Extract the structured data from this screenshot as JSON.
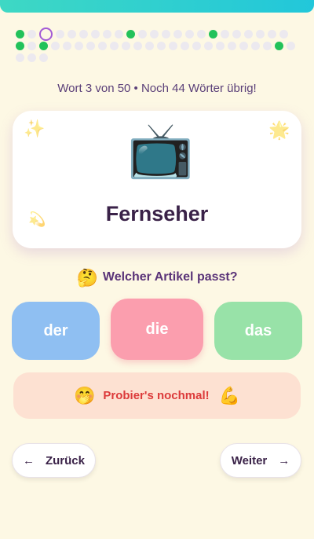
{
  "progress": {
    "total": 50,
    "current_index": 2,
    "done_indices": [
      0,
      9,
      16,
      23,
      25,
      45
    ],
    "text": "Wort 3 von 50  • Noch 44 Wörter übrig!"
  },
  "card": {
    "icon": "📺",
    "icon_name": "television-icon",
    "word": "Fernseher"
  },
  "question": {
    "emoji": "🤔",
    "text": "Welcher Artikel passt?"
  },
  "articles": [
    {
      "label": "der",
      "color": "#8fbff2"
    },
    {
      "label": "die",
      "color": "#fb9eae"
    },
    {
      "label": "das",
      "color": "#98e2a8"
    }
  ],
  "feedback": {
    "emoji_left": "🤭",
    "text": "Probier's nochmal!",
    "emoji_right": "💪",
    "color": "#dc3a3a"
  },
  "nav": {
    "back_label": "Zurück",
    "back_arrow": "←",
    "next_label": "Weiter",
    "next_arrow": "→"
  },
  "colors": {
    "background": "#fdf8e4",
    "done_dot": "#22c25a",
    "current_dot": "#a35bd6",
    "topbar": "#22c7da"
  }
}
